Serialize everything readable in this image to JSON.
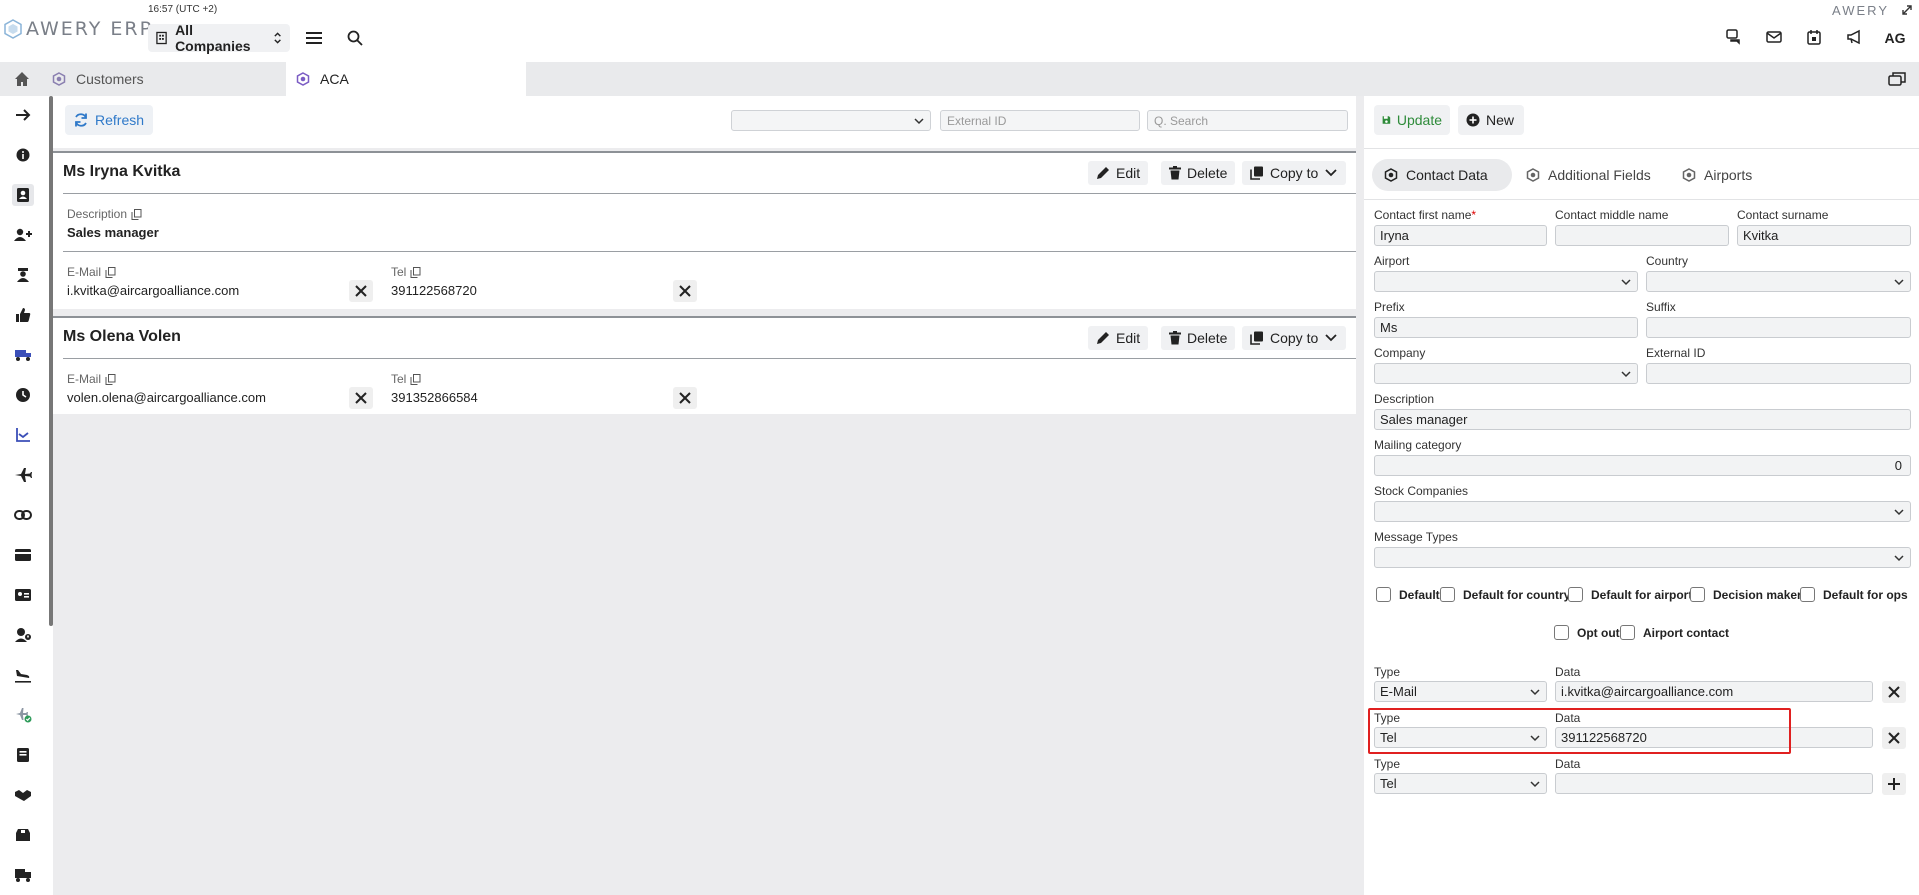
{
  "app": {
    "logo_text": "AWERY ERP",
    "brand_right": "AWERY",
    "clock": "16:57 (UTC +2)",
    "company_selector": "All Companies",
    "avatar_initials": "AG"
  },
  "tabs": [
    {
      "label": "Customers"
    },
    {
      "label": "ACA"
    }
  ],
  "toolbar": {
    "refresh_label": "Refresh",
    "external_id_placeholder": "External ID",
    "search_placeholder": "Q. Search"
  },
  "contacts": [
    {
      "name": "Ms Iryna Kvitka",
      "description_label": "Description",
      "description": "Sales manager",
      "email_label": "E-Mail",
      "email": "i.kvitka@aircargoalliance.com",
      "tel_label": "Tel",
      "tel": "391122568720"
    },
    {
      "name": "Ms Olena Volen",
      "email_label": "E-Mail",
      "email": "volen.olena@aircargoalliance.com",
      "tel_label": "Tel",
      "tel": "391352866584"
    }
  ],
  "card_actions": {
    "edit": "Edit",
    "delete": "Delete",
    "copy_to": "Copy to"
  },
  "right_panel": {
    "update_label": "Update",
    "new_label": "New",
    "tabs": [
      {
        "label": "Contact Data"
      },
      {
        "label": "Additional Fields"
      },
      {
        "label": "Airports"
      }
    ],
    "fields": {
      "first_name_label": "Contact first name",
      "first_name": "Iryna",
      "middle_name_label": "Contact middle name",
      "middle_name": "",
      "surname_label": "Contact surname",
      "surname": "Kvitka",
      "airport_label": "Airport",
      "country_label": "Country",
      "prefix_label": "Prefix",
      "prefix": "Ms",
      "suffix_label": "Suffix",
      "company_label": "Company",
      "external_id_label": "External ID",
      "description_label": "Description",
      "description": "Sales manager",
      "mailing_category_label": "Mailing category",
      "mailing_category": "0",
      "stock_companies_label": "Stock Companies",
      "message_types_label": "Message Types"
    },
    "checkboxes": [
      {
        "label": "Default"
      },
      {
        "label": "Default for country"
      },
      {
        "label": "Default for airport"
      },
      {
        "label": "Decision maker"
      },
      {
        "label": "Default for ops"
      },
      {
        "label": "Opt out"
      },
      {
        "label": "Airport contact"
      }
    ],
    "comm_rows": [
      {
        "type_label": "Type",
        "type": "E-Mail",
        "data_label": "Data",
        "data": "i.kvitka@aircargoalliance.com"
      },
      {
        "type_label": "Type",
        "type": "Tel",
        "data_label": "Data",
        "data": "391122568720"
      },
      {
        "type_label": "Type",
        "type": "Tel",
        "data_label": "Data",
        "data": ""
      }
    ]
  },
  "colors": {
    "accent_blue": "#2f79c9",
    "update_green": "#2e8b3a",
    "highlight_red": "#e02020",
    "tab_hex": "#7b5cc4"
  }
}
